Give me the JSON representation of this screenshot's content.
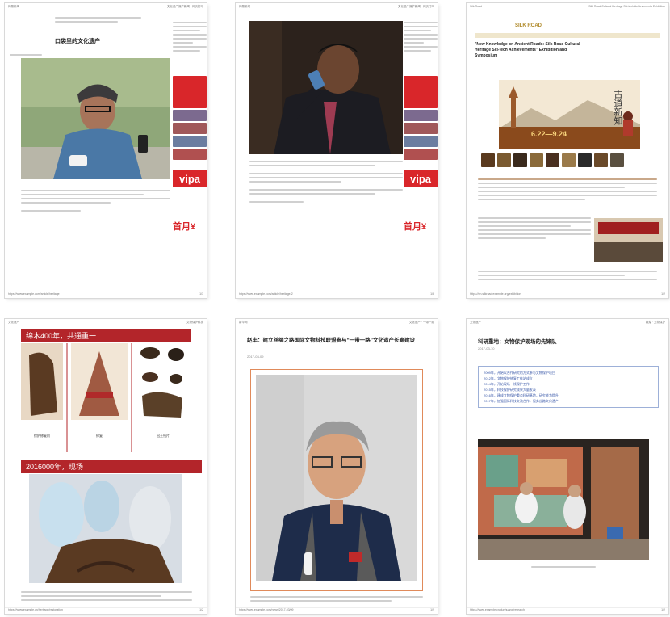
{
  "pages": [
    {
      "header_left": "网易新闻",
      "header_center": "文化遗产保护新闻 · 网页打印",
      "title": "口袋里的文化遗产",
      "footer_left": "https://www.example.com/article/heritage",
      "footer_right": "1/3",
      "ad_big_text": "vipa",
      "ad_bottom_text": "首月¥"
    },
    {
      "header_left": "网易新闻",
      "header_center": "文化遗产保护新闻 · 网页打印",
      "footer_left": "https://www.example.com/article/heritage-2",
      "footer_right": "1/3",
      "ad_big_text": "vipa",
      "ad_bottom_text": "首月¥"
    },
    {
      "header_left": "Silk Road",
      "header_center": "Silk Road Cultural Heritage Sci-tech Achievements Exhibition",
      "site_name": "SILK ROAD",
      "title": "\"New Knowledge on Ancient Roads: Silk Road Cultural Heritage Sci-tech Achievements\" Exhibition and Symposium",
      "banner_text": "古道新知",
      "banner_date": "6.22—9.24",
      "footer_left": "https://en.silkroad.example.org/exhibition",
      "footer_right": "1/2"
    },
    {
      "header_left": "文化遗产",
      "header_center": "文物保护科技",
      "section1": "绵木400年，共通重一",
      "caption1": "保护修复前",
      "caption2": "修复",
      "caption3": "出土残片",
      "section2": "2016000年，现场",
      "footer_left": "https://www.example.cn/heritage/restoration",
      "footer_right": "1/2"
    },
    {
      "header_left": "新华网",
      "header_center": "文化遗产 · 一带一路",
      "title": "赵丰：建立丝绸之路国际文物科技联盟参与“一带一路”文化遗产长廊建设",
      "date": "2017-03-09",
      "footer_left": "https://www.example.com/news/2017-03/09",
      "footer_right": "1/2"
    },
    {
      "header_left": "文化遗产",
      "header_center": "敦煌 · 文物保护",
      "title": "科研重地：文物保护现场的先锋队",
      "date": "2017-03-10",
      "list": [
        "2009年，开始以合作研究的方式参与文物保护项目",
        "2012年，文物保护修复工作站成立",
        "2014年，开始现场一线保护工作",
        "2015年，科技保护研究成果大量发表",
        "2016年，建成文物保护重点科研基地，研究能力提升",
        "2017年，加强国际科技交流合作，服务丝路文化遗产"
      ],
      "footer_left": "https://www.example.cn/dunhuang/research",
      "footer_right": "1/2"
    }
  ]
}
